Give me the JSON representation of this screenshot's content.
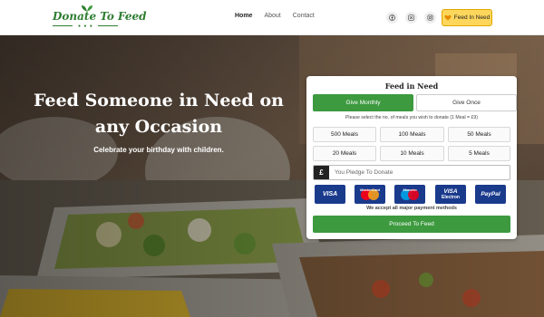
{
  "header": {
    "logo_text": "Donate To Feed",
    "logo_dots": "● ● ●",
    "nav": [
      {
        "label": "Home",
        "active": true
      },
      {
        "label": "About",
        "active": false
      },
      {
        "label": "Contact",
        "active": false
      }
    ],
    "social_icons": [
      "facebook-icon",
      "x-twitter-icon",
      "instagram-icon"
    ],
    "cta_label": "Feed In Need",
    "cta_icon": "heart-hand-icon",
    "cta_color": "#fdd65b"
  },
  "hero": {
    "title": "Feed Someone in Need on any Occasion",
    "subtitle": "Celebrate your birthday with children."
  },
  "donation": {
    "title": "Feed in Need",
    "tabs": [
      {
        "label": "Give Monthly",
        "selected": true
      },
      {
        "label": "Give Once",
        "selected": false
      }
    ],
    "note": "Please select the no. of meals you wish to donate (1 Meal = £9)",
    "meal_options": [
      "500 Meals",
      "100 Meals",
      "50 Meals",
      "20 Meals",
      "10 Meals",
      "5 Meals"
    ],
    "currency_symbol": "£",
    "pledge_placeholder": "You Pledge To Donate",
    "payment_methods": {
      "visa": "VISA",
      "mastercard": "MasterCard",
      "maestro": "Maestro",
      "electron_top": "VISA",
      "electron_bottom": "Electron",
      "paypal": "PayPal"
    },
    "payment_note": "We accept all major payment methods",
    "proceed_label": "Proceed To Feed",
    "accent_color": "#3d9a3f"
  }
}
